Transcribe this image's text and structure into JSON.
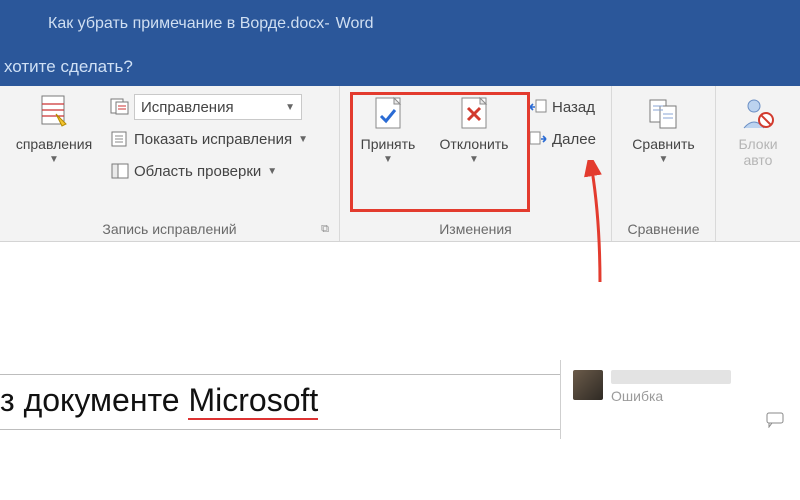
{
  "title": {
    "doc": "Как убрать примечание в Ворде.docx",
    "sep": " - ",
    "app": "Word"
  },
  "tellme": "хотите сделать?",
  "ribbon": {
    "tracking": {
      "big": "справления",
      "combo": "Исправления",
      "show": "Показать исправления",
      "pane": "Область проверки",
      "group": "Запись исправлений"
    },
    "changes": {
      "accept": "Принять",
      "reject": "Отклонить",
      "prev": "Назад",
      "next": "Далее",
      "group": "Изменения"
    },
    "compare": {
      "label": "Сравнить",
      "group": "Сравнение"
    },
    "protect": {
      "label1": "Блоки",
      "label2": "авто"
    }
  },
  "document": {
    "text_prefix": "з документе ",
    "text_underlined": "Microsoft"
  },
  "comment": {
    "error": "Ошибка"
  }
}
